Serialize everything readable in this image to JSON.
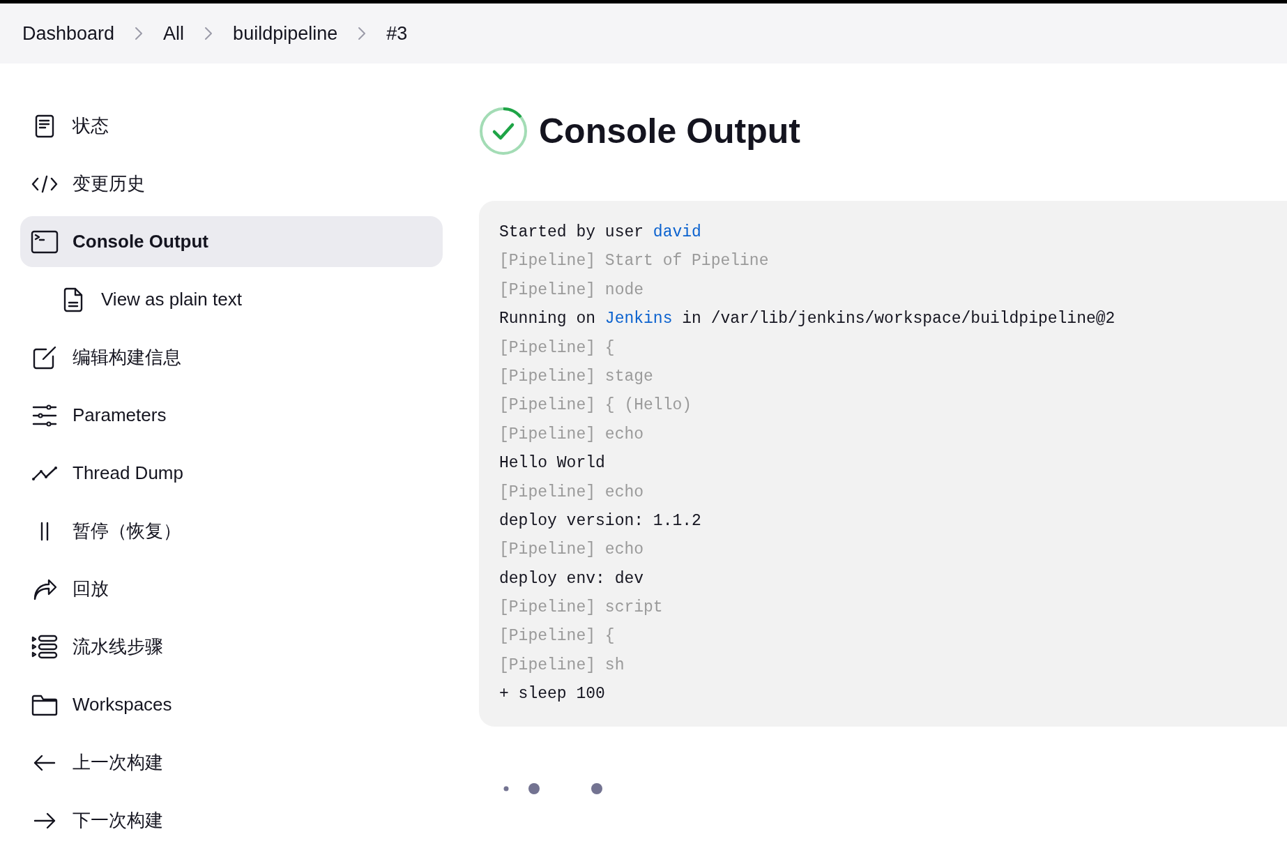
{
  "breadcrumbs": [
    {
      "label": "Dashboard"
    },
    {
      "label": "All"
    },
    {
      "label": "buildpipeline"
    },
    {
      "label": "#3"
    }
  ],
  "sidebar": {
    "items": [
      {
        "label": "状态",
        "selected": false
      },
      {
        "label": "变更历史",
        "selected": false
      },
      {
        "label": "Console Output",
        "selected": true,
        "children": [
          {
            "label": "View as plain text",
            "selected": false
          }
        ]
      },
      {
        "label": "编辑构建信息",
        "selected": false
      },
      {
        "label": "Parameters",
        "selected": false
      },
      {
        "label": "Thread Dump",
        "selected": false
      },
      {
        "label": "暂停（恢复）",
        "selected": false
      },
      {
        "label": "回放",
        "selected": false
      },
      {
        "label": "流水线步骤",
        "selected": false
      },
      {
        "label": "Workspaces",
        "selected": false
      },
      {
        "label": "上一次构建",
        "selected": false
      },
      {
        "label": "下一次构建",
        "selected": false
      }
    ]
  },
  "page": {
    "title": "Console Output",
    "status_icon": {
      "kind": "success"
    }
  },
  "console": {
    "lines": [
      {
        "kind": "output",
        "parts": [
          {
            "text": "Started by user ",
            "link": false
          },
          {
            "text": "david",
            "link": true
          }
        ]
      },
      {
        "kind": "pipeline",
        "parts": [
          {
            "text": "[Pipeline] Start of Pipeline",
            "link": false
          }
        ]
      },
      {
        "kind": "pipeline",
        "parts": [
          {
            "text": "[Pipeline] node",
            "link": false
          }
        ]
      },
      {
        "kind": "output",
        "parts": [
          {
            "text": "Running on ",
            "link": false
          },
          {
            "text": "Jenkins",
            "link": true
          },
          {
            "text": " in /var/lib/jenkins/workspace/buildpipeline@2",
            "link": false
          }
        ]
      },
      {
        "kind": "pipeline",
        "parts": [
          {
            "text": "[Pipeline] {",
            "link": false
          }
        ]
      },
      {
        "kind": "pipeline",
        "parts": [
          {
            "text": "[Pipeline] stage",
            "link": false
          }
        ]
      },
      {
        "kind": "pipeline",
        "parts": [
          {
            "text": "[Pipeline] { (Hello)",
            "link": false
          }
        ]
      },
      {
        "kind": "pipeline",
        "parts": [
          {
            "text": "[Pipeline] echo",
            "link": false
          }
        ]
      },
      {
        "kind": "output",
        "parts": [
          {
            "text": "Hello World",
            "link": false
          }
        ]
      },
      {
        "kind": "pipeline",
        "parts": [
          {
            "text": "[Pipeline] echo",
            "link": false
          }
        ]
      },
      {
        "kind": "output",
        "parts": [
          {
            "text": "deploy version: 1.1.2",
            "link": false
          }
        ]
      },
      {
        "kind": "pipeline",
        "parts": [
          {
            "text": "[Pipeline] echo",
            "link": false
          }
        ]
      },
      {
        "kind": "output",
        "parts": [
          {
            "text": "deploy env: dev",
            "link": false
          }
        ]
      },
      {
        "kind": "pipeline",
        "parts": [
          {
            "text": "[Pipeline] script",
            "link": false
          }
        ]
      },
      {
        "kind": "pipeline",
        "parts": [
          {
            "text": "[Pipeline] {",
            "link": false
          }
        ]
      },
      {
        "kind": "pipeline",
        "parts": [
          {
            "text": "[Pipeline] sh",
            "link": false
          }
        ]
      },
      {
        "kind": "output",
        "parts": [
          {
            "text": "+ sleep 100",
            "link": false
          }
        ]
      }
    ]
  }
}
